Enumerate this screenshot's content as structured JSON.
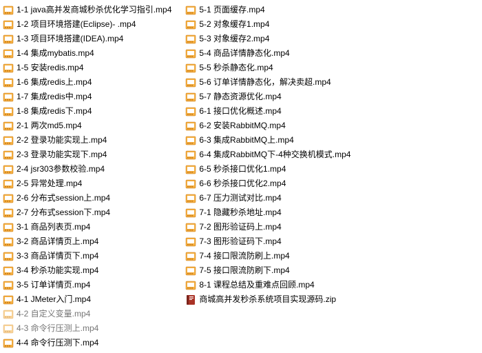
{
  "files": [
    {
      "name": "1-1 java高并发商城秒杀优化学习指引.mp4",
      "type": "video"
    },
    {
      "name": "1-2 项目环境搭建(Eclipse)- .mp4",
      "type": "video"
    },
    {
      "name": "1-3 项目环境搭建(IDEA).mp4",
      "type": "video"
    },
    {
      "name": "1-4 集成mybatis.mp4",
      "type": "video"
    },
    {
      "name": "1-5 安装redis.mp4",
      "type": "video"
    },
    {
      "name": "1-6 集成redis上.mp4",
      "type": "video"
    },
    {
      "name": "1-7 集成redis中.mp4",
      "type": "video"
    },
    {
      "name": "1-8 集成redis下.mp4",
      "type": "video"
    },
    {
      "name": "2-1 两次md5.mp4",
      "type": "video"
    },
    {
      "name": "2-2 登录功能实现上.mp4",
      "type": "video"
    },
    {
      "name": "2-3 登录功能实现下.mp4",
      "type": "video"
    },
    {
      "name": "2-4 jsr303参数校验.mp4",
      "type": "video"
    },
    {
      "name": "2-5 异常处理.mp4",
      "type": "video"
    },
    {
      "name": "2-6 分布式session上.mp4",
      "type": "video"
    },
    {
      "name": "2-7 分布式session下.mp4",
      "type": "video"
    },
    {
      "name": "3-1 商品列表页.mp4",
      "type": "video"
    },
    {
      "name": "3-2 商品详情页上.mp4",
      "type": "video"
    },
    {
      "name": "3-3 商品详情页下.mp4",
      "type": "video"
    },
    {
      "name": "3-4 秒杀功能实现.mp4",
      "type": "video"
    },
    {
      "name": "3-5 订单详情页.mp4",
      "type": "video"
    },
    {
      "name": "4-1 JMeter入门.mp4",
      "type": "video"
    },
    {
      "name": "4-2 自定义变量.mp4",
      "type": "video",
      "greyed": true
    },
    {
      "name": "4-3 命令行压测上.mp4",
      "type": "video",
      "greyed": true
    },
    {
      "name": "4-4 命令行压测下.mp4",
      "type": "video"
    },
    {
      "name": "5-1 页面缓存.mp4",
      "type": "video"
    },
    {
      "name": "5-2 对象缓存1.mp4",
      "type": "video"
    },
    {
      "name": "5-3 对象缓存2.mp4",
      "type": "video"
    },
    {
      "name": "5-4 商品详情静态化.mp4",
      "type": "video"
    },
    {
      "name": "5-5 秒杀静态化.mp4",
      "type": "video"
    },
    {
      "name": "5-6 订单详情静态化，解决卖超.mp4",
      "type": "video"
    },
    {
      "name": "5-7 静态资源优化.mp4",
      "type": "video"
    },
    {
      "name": "6-1 接口优化概述.mp4",
      "type": "video"
    },
    {
      "name": "6-2 安装RabbitMQ.mp4",
      "type": "video"
    },
    {
      "name": "6-3 集成RabbitMQ上.mp4",
      "type": "video"
    },
    {
      "name": "6-4 集成RabbitMQ下-4种交换机模式.mp4",
      "type": "video"
    },
    {
      "name": "6-5 秒杀接口优化1.mp4",
      "type": "video"
    },
    {
      "name": "6-6 秒杀接口优化2.mp4",
      "type": "video"
    },
    {
      "name": "6-7 压力测试对比.mp4",
      "type": "video"
    },
    {
      "name": "7-1 隐藏秒杀地址.mp4",
      "type": "video"
    },
    {
      "name": "7-2 图形验证码上.mp4",
      "type": "video"
    },
    {
      "name": "7-3 图形验证码下.mp4",
      "type": "video"
    },
    {
      "name": "7-4 接口限流防刷上.mp4",
      "type": "video"
    },
    {
      "name": "7-5 接口限流防刷下.mp4",
      "type": "video"
    },
    {
      "name": "8-1 课程总结及重难点回顾.mp4",
      "type": "video"
    },
    {
      "name": "商城高并发秒杀系统项目实现源码.zip",
      "type": "zip"
    }
  ]
}
